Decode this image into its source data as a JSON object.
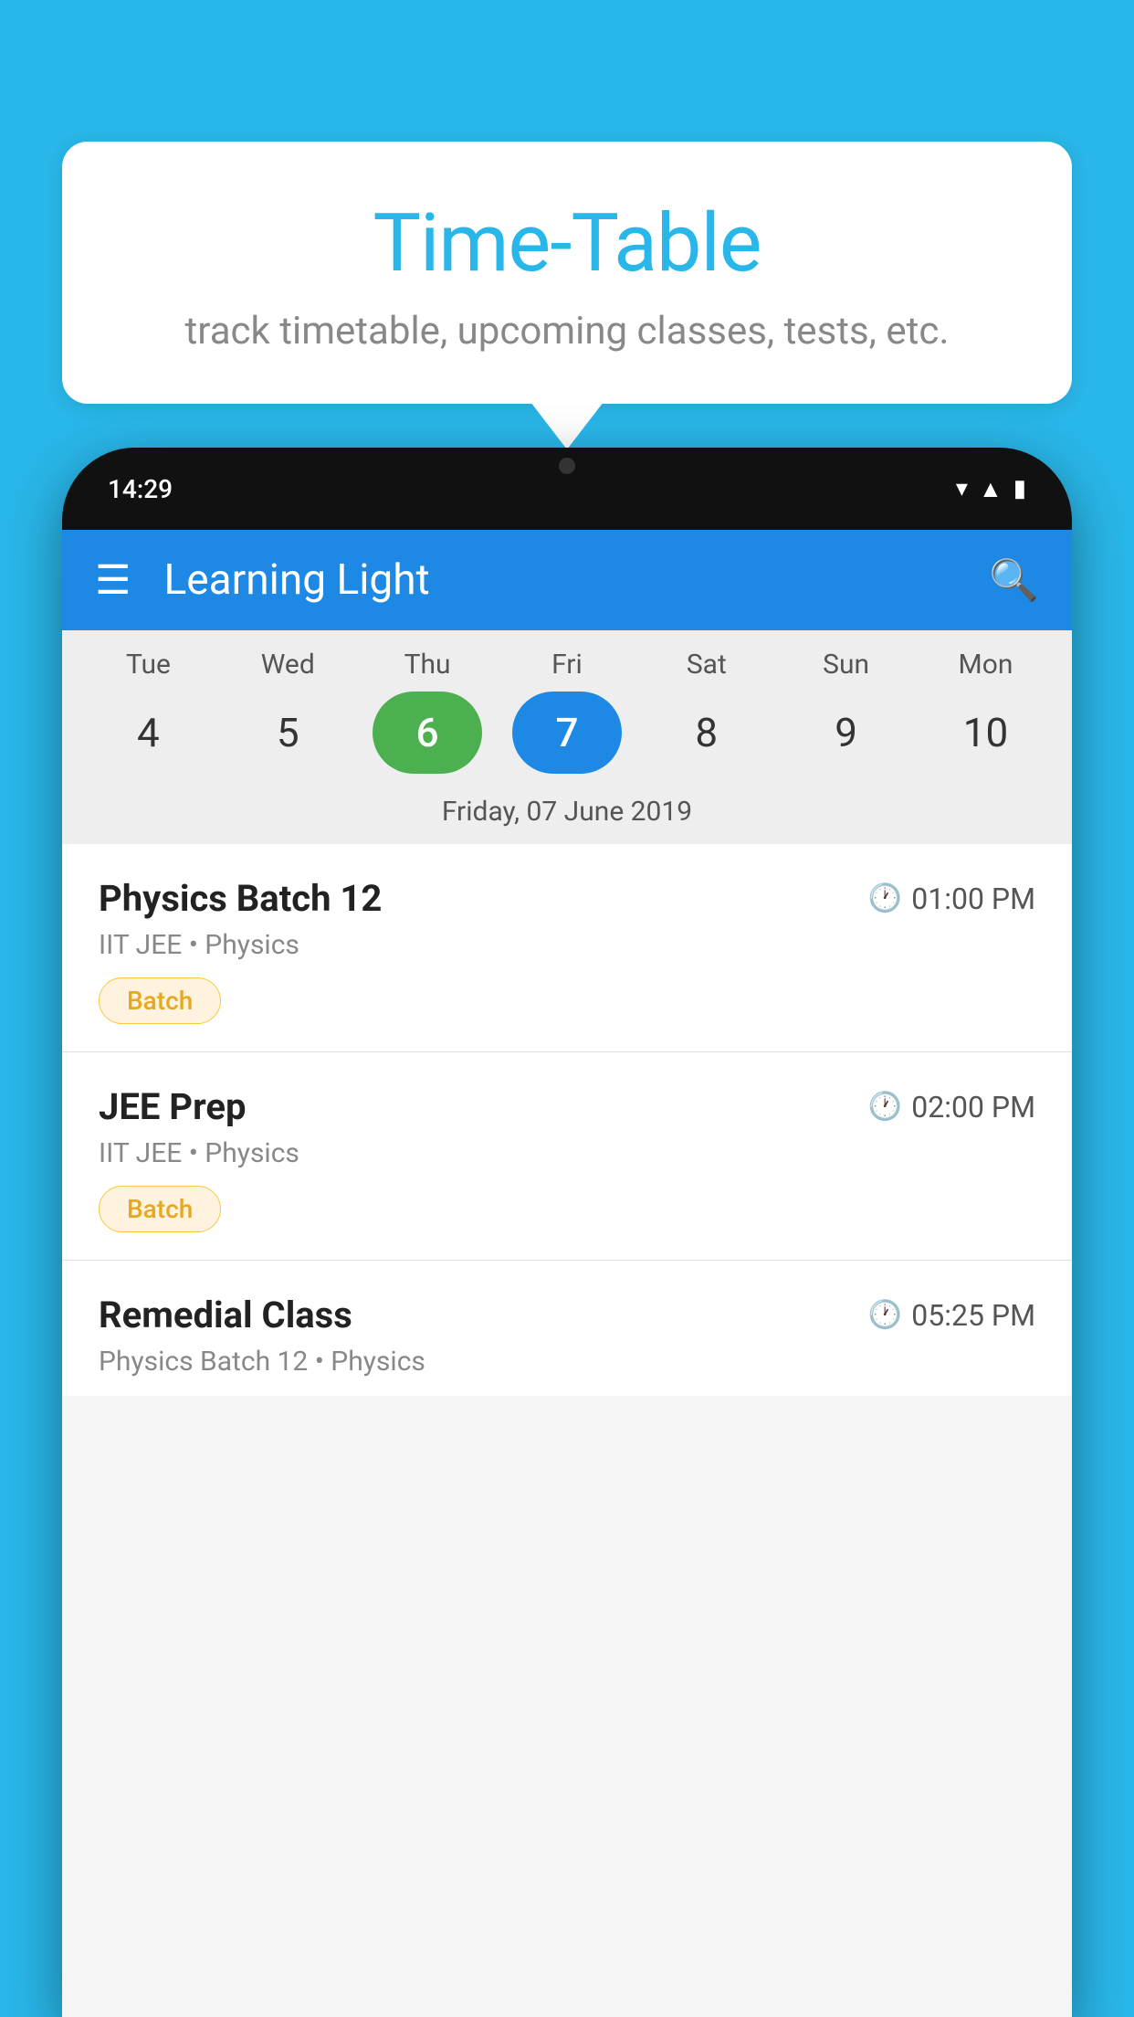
{
  "background_color": "#29B6E8",
  "bubble": {
    "title": "Time-Table",
    "subtitle": "track timetable, upcoming classes, tests, etc."
  },
  "status_bar": {
    "time": "14:29",
    "icons": [
      "wifi",
      "signal",
      "battery"
    ]
  },
  "app_bar": {
    "title": "Learning Light"
  },
  "calendar": {
    "days": [
      {
        "abbr": "Tue",
        "num": "4"
      },
      {
        "abbr": "Wed",
        "num": "5"
      },
      {
        "abbr": "Thu",
        "num": "6",
        "state": "today"
      },
      {
        "abbr": "Fri",
        "num": "7",
        "state": "selected"
      },
      {
        "abbr": "Sat",
        "num": "8"
      },
      {
        "abbr": "Sun",
        "num": "9"
      },
      {
        "abbr": "Mon",
        "num": "10"
      }
    ],
    "selected_date": "Friday, 07 June 2019"
  },
  "classes": [
    {
      "name": "Physics Batch 12",
      "time": "01:00 PM",
      "subtitle": "IIT JEE • Physics",
      "badge": "Batch"
    },
    {
      "name": "JEE Prep",
      "time": "02:00 PM",
      "subtitle": "IIT JEE • Physics",
      "badge": "Batch"
    },
    {
      "name": "Remedial Class",
      "time": "05:25 PM",
      "subtitle": "Physics Batch 12 • Physics",
      "badge": null
    }
  ]
}
